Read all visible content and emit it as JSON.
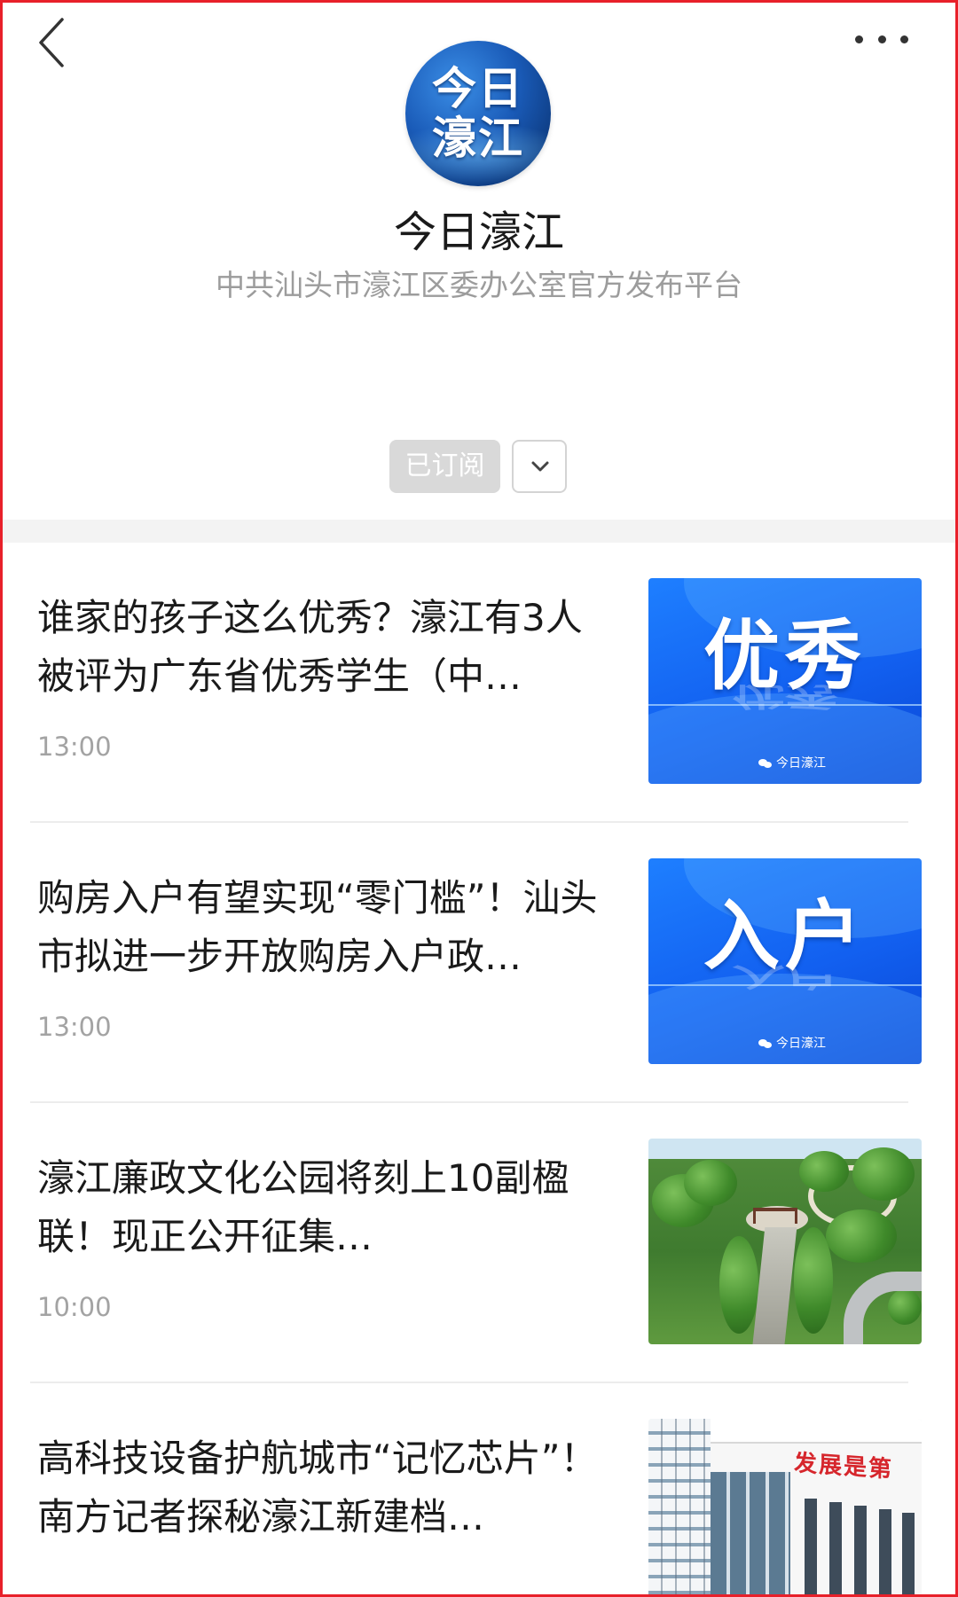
{
  "nav": {
    "back_icon": "chevron-left-icon",
    "more_icon": "more-dots-icon"
  },
  "account": {
    "logo_text_line1": "今日",
    "logo_text_line2": "濠江",
    "name": "今日濠江",
    "description": "中共汕头市濠江区委办公室官方发布平台",
    "subscribe_label": "已订阅",
    "dropdown_icon": "chevron-down-icon"
  },
  "articles": [
    {
      "title": "谁家的孩子这么优秀？濠江有3人被评为广东省优秀学生（中…",
      "time": "13:00",
      "thumb_text": "优秀",
      "thumb_brand": "今日濠江"
    },
    {
      "title": "购房入户有望实现“零门槛”！汕头市拟进一步开放购房入户政…",
      "time": "13:00",
      "thumb_text": "入户",
      "thumb_brand": "今日濠江"
    },
    {
      "title": "濠江廉政文化公园将刻上10副楹联！现正公开征集…",
      "time": "10:00"
    },
    {
      "title": "高科技设备护航城市“记忆芯片”！南方记者探秘濠江新建档…",
      "thumb_sign": "发展是第"
    }
  ],
  "colors": {
    "frame": "#e8202a",
    "accent_blue": "#1260f0",
    "subscribed_bg": "#d9d9d9",
    "time_text": "#a3a3a3",
    "desc_text": "#9c9c9c"
  }
}
